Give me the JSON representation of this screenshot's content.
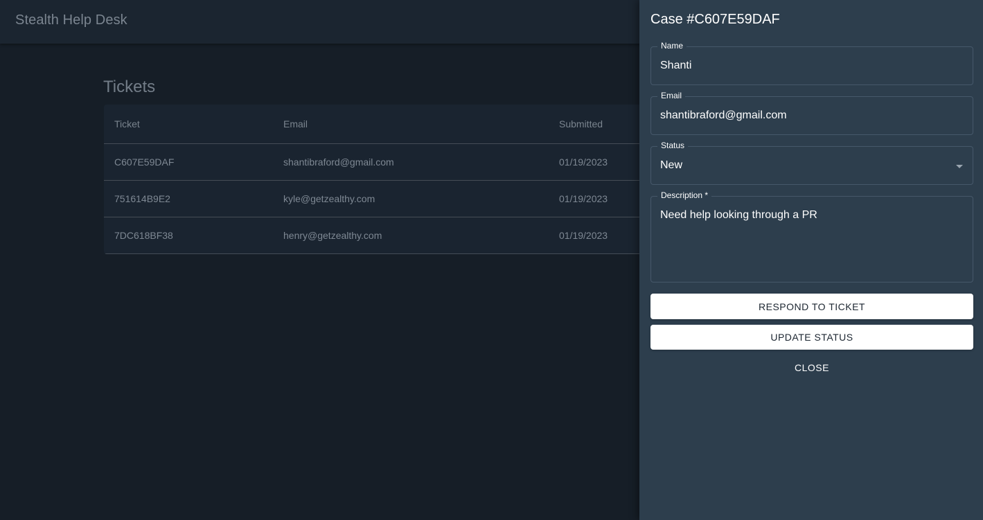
{
  "app": {
    "title": "Stealth Help Desk"
  },
  "page": {
    "heading": "Tickets"
  },
  "table": {
    "columns": [
      "Ticket",
      "Email",
      "Submitted"
    ],
    "rows": [
      {
        "ticket": "C607E59DAF",
        "email": "shantibraford@gmail.com",
        "submitted": "01/19/2023"
      },
      {
        "ticket": "751614B9E2",
        "email": "kyle@getzealthy.com",
        "submitted": "01/19/2023"
      },
      {
        "ticket": "7DC618BF38",
        "email": "henry@getzealthy.com",
        "submitted": "01/19/2023"
      }
    ]
  },
  "drawer": {
    "title": "Case #C607E59DAF",
    "name": {
      "label": "Name",
      "value": "Shanti"
    },
    "email": {
      "label": "Email",
      "value": "shantibraford@gmail.com"
    },
    "status": {
      "label": "Status",
      "value": "New"
    },
    "description": {
      "label": "Description *",
      "value": "Need help looking through a PR"
    },
    "respond_label": "RESPOND TO TICKET",
    "update_label": "UPDATE STATUS",
    "close_label": "CLOSE"
  },
  "colors": {
    "background": "#161e27",
    "app_bar": "#1b2530",
    "drawer": "#2d3e4d",
    "button": "#ffffff"
  },
  "icons": {
    "status_dropdown": "chevron-down-icon"
  }
}
